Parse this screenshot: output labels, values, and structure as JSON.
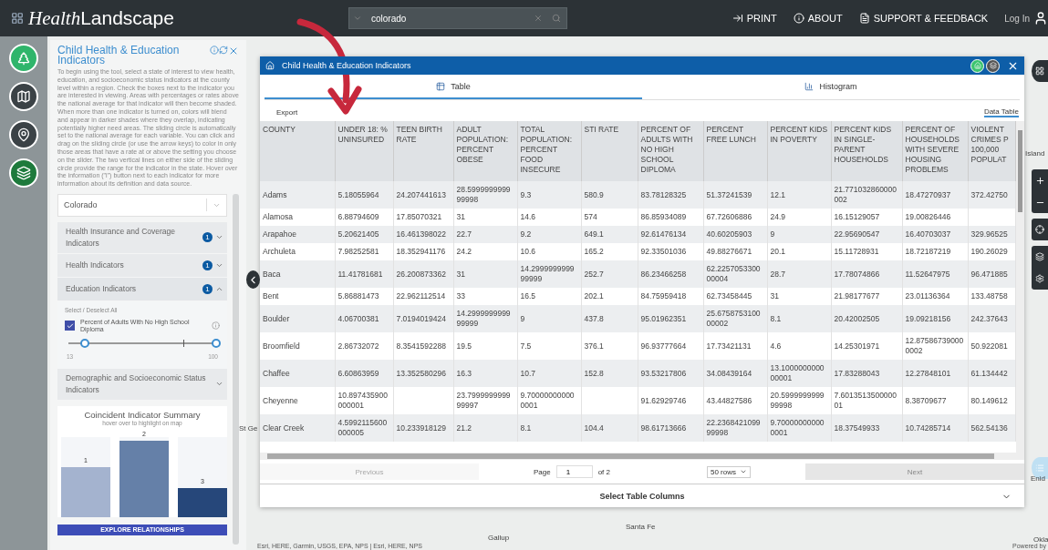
{
  "topbar": {
    "logo_italic": "Health",
    "logo_rest": "Landscape",
    "search": {
      "value": "colorado"
    },
    "links": [
      {
        "kind": "print",
        "label": "PRINT"
      },
      {
        "kind": "about",
        "label": "ABOUT"
      },
      {
        "kind": "support",
        "label": "SUPPORT & FEEDBACK"
      }
    ],
    "login": "Log In"
  },
  "rail": [
    {
      "kind": "tree",
      "color": "#2fb56b"
    },
    {
      "kind": "map",
      "color": "#3b4246"
    },
    {
      "kind": "pin",
      "color": "#3b4246"
    },
    {
      "kind": "layers",
      "color": "#1e7a3c"
    }
  ],
  "panel": {
    "title": "Child Health & Education Indicators",
    "description": "To begin using the tool, select a state of interest to view health, education, and socioeconomic status indicators at the county level within a region. Check the boxes next to the indicator you are interested in viewing. Areas with percentages or rates above the national average for that indicator will then become shaded. When more than one indicator is turned on, colors will blend and appear in darker shades where they overlap, indicating potentially higher need areas. The sliding circle is automatically set to the national average for each variable. You can click and drag on the sliding circle (or use the arrow keys) to color in only those areas that have a rate at or above the setting you choose on the slider. The two vertical lines on either side of the sliding circle provide the range for the indicator in the state. Hover over the information (\"i\") button next to each indicator for more information about its definition and data source.",
    "state": "Colorado",
    "sections": [
      {
        "title": "Health Insurance and Coverage Indicators",
        "badge": "1",
        "expanded": false
      },
      {
        "title": "Health Indicators",
        "badge": "1",
        "expanded": false
      },
      {
        "title": "Education Indicators",
        "badge": "1",
        "expanded": true,
        "select_all": "Select / Deselect All",
        "indicators": [
          {
            "label": "Percent of Adults With No High School Diploma",
            "checked": true,
            "thumbs": [
              {
                "level": 0.11
              },
              {
                "level": 1
              }
            ],
            "min": "13",
            "max": "100"
          }
        ]
      },
      {
        "title": "Demographic and Socioeconomic Status Indicators",
        "expanded": false
      }
    ],
    "summary": {
      "title": "Coincident Indicator Summary",
      "subtitle": "hover over to highlight on map",
      "bars": [
        {
          "label": "1",
          "level": 0.62,
          "color": "#a4b3cf"
        },
        {
          "label": "2",
          "level": 0.95,
          "color": "#6580a8"
        },
        {
          "label": "3",
          "level": 0.36,
          "color": "#26477a"
        }
      ]
    },
    "explore_button": "EXPLORE RELATIONSHIPS"
  },
  "modal": {
    "title": "Child Health & Education Indicators",
    "tabs": [
      {
        "kind": "table",
        "label": "Table",
        "selected": true
      },
      {
        "kind": "histogram",
        "label": "Histogram",
        "selected": false
      }
    ],
    "export": "Export",
    "data_table": "Data Table",
    "table": {
      "columns": [
        "COUNTY",
        "UNDER 18: % UNINSURED",
        "TEEN BIRTH RATE",
        "ADULT POPULATION: PERCENT OBESE",
        "TOTAL POPULATION: PERCENT FOOD INSECURE",
        "STI RATE",
        "PERCENT OF ADULTS WITH NO HIGH SCHOOL DIPLOMA",
        "PERCENT FREE LUNCH",
        "PERCENT KIDS IN POVERTY",
        "PERCENT KIDS IN SINGLE-PARENT HOUSEHOLDS",
        "PERCENT OF HOUSEHOLDS WITH SEVERE HOUSING PROBLEMS",
        "VIOLENT CRIMES P 100,000 POPULAT"
      ],
      "rows": [
        [
          "Adams",
          "5.18055964",
          "24.207441613",
          "28.599999999999998",
          "9.3",
          "580.9",
          "83.78128325",
          "51.37241539",
          "12.1",
          "21.771032860000002",
          "18.47270937",
          "372.42750"
        ],
        [
          "Alamosa",
          "6.88794609",
          "17.85070321",
          "31",
          "14.6",
          "574",
          "86.85934089",
          "67.72606886",
          "24.9",
          "16.15129057",
          "19.00826446",
          null
        ],
        [
          "Arapahoe",
          "5.20621405",
          "16.461398022",
          "22.7",
          "9.2",
          "649.1",
          "92.61476134",
          "40.60205903",
          "9",
          "22.95690547",
          "16.40703037",
          "329.96525"
        ],
        [
          "Archuleta",
          "7.98252581",
          "18.352941176",
          "24.2",
          "10.6",
          "165.2",
          "92.33501036",
          "49.88276671",
          "20.1",
          "15.11728931",
          "18.72187219",
          "190.26029"
        ],
        [
          "Baca",
          "11.41781681",
          "26.200873362",
          "31",
          "14.299999999999999",
          "252.7",
          "86.23466258",
          "62.225705330000004",
          "28.7",
          "17.78074866",
          "11.52647975",
          "96.471885"
        ],
        [
          "Bent",
          "5.86881473",
          "22.962112514",
          "33",
          "16.5",
          "202.1",
          "84.75959418",
          "62.73458445",
          "31",
          "21.98177677",
          "23.01136364",
          "133.48758"
        ],
        [
          "Boulder",
          "4.06700381",
          "7.0194019424",
          "14.299999999999999",
          "9",
          "437.8",
          "95.01962351",
          "25.675875310000002",
          "8.1",
          "20.42002505",
          "19.09218156",
          "242.37643"
        ],
        [
          "Broomfield",
          "2.86732072",
          "8.3541592288",
          "19.5",
          "7.5",
          "376.1",
          "96.93777664",
          "17.73421131",
          "4.6",
          "14.25301971",
          "12.875867390000002",
          "50.922081"
        ],
        [
          "Chaffee",
          "6.60863959",
          "13.352580296",
          "16.3",
          "10.7",
          "152.8",
          "93.53217806",
          "34.08439164",
          "13.100000000000001",
          "17.83288043",
          "12.27848101",
          "61.134442"
        ],
        [
          "Cheyenne",
          "10.897435900000001",
          null,
          "23.799999999999997",
          "9.700000000000001",
          null,
          "91.62929746",
          "43.44827586",
          "20.599999999999998",
          "7.601351350000001",
          "8.38709677",
          "80.149612"
        ],
        [
          "Clear Creek",
          "4.5992115600000005",
          "10.233918129",
          "21.2",
          "8.1",
          "104.4",
          "98.61713666",
          "22.236842109999998",
          "9.700000000000001",
          "18.37549933",
          "10.74285714",
          "562.54136"
        ]
      ]
    },
    "pager": {
      "previous": {
        "label": "Previous",
        "disabled": true
      },
      "page_label": "Page",
      "page": "1",
      "of": "of 2",
      "rows": "50 rows",
      "next": {
        "label": "Next",
        "disabled": false
      }
    },
    "columns_button": "Select Table Columns"
  },
  "map": {
    "labels": [
      {
        "text": "Island"
      },
      {
        "text": "St Ge"
      },
      {
        "text": "Enid"
      },
      {
        "text": "Santa Fe"
      },
      {
        "text": "Gallup"
      },
      {
        "text": "Okla"
      }
    ],
    "attribution": "Esri, HERE, Garmin, USGS, EPA, NPS | Esri, HERE, NPS",
    "powered": "Powered by"
  }
}
